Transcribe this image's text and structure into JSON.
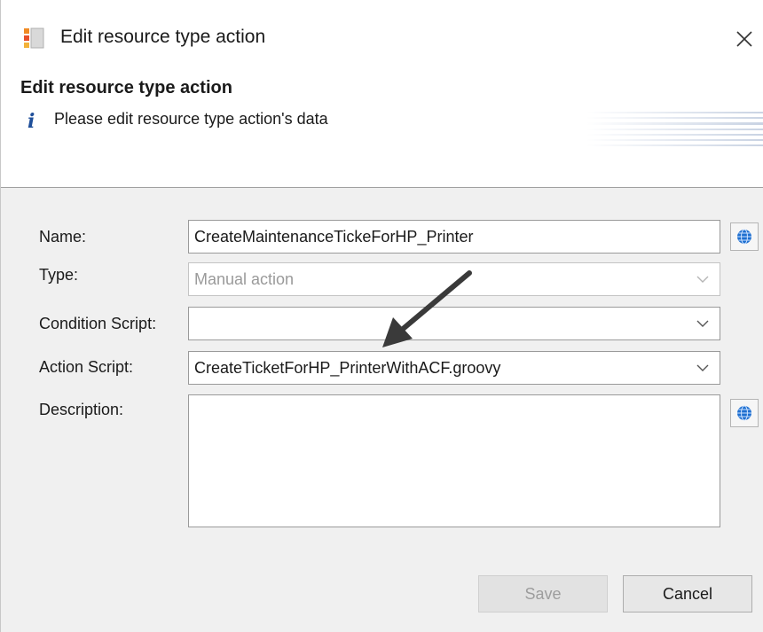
{
  "window": {
    "title": "Edit resource type action",
    "close_icon": "close-icon"
  },
  "header": {
    "title": "Edit resource type action",
    "info_icon": "i",
    "message": "Please edit resource type action's data"
  },
  "form": {
    "name": {
      "label": "Name:",
      "value": "CreateMaintenanceTickeForHP_Printer"
    },
    "type": {
      "label": "Type:",
      "value": "Manual action",
      "disabled": true
    },
    "condition_script": {
      "label": "Condition Script:",
      "value": ""
    },
    "action_script": {
      "label": "Action Script:",
      "value": "CreateTicketForHP_PrinterWithACF.groovy"
    },
    "description": {
      "label": "Description:",
      "value": ""
    }
  },
  "buttons": {
    "save": "Save",
    "cancel": "Cancel"
  },
  "colors": {
    "body_bg": "#f0f0f0",
    "info_icon": "#1f4f9a",
    "globe": "#1e6fd0",
    "annotation_arrow": "#3a3a3a"
  },
  "icons": [
    "app-icon",
    "close-icon",
    "info-icon",
    "globe-icon",
    "chevron-down-icon",
    "annotation-arrow"
  ]
}
